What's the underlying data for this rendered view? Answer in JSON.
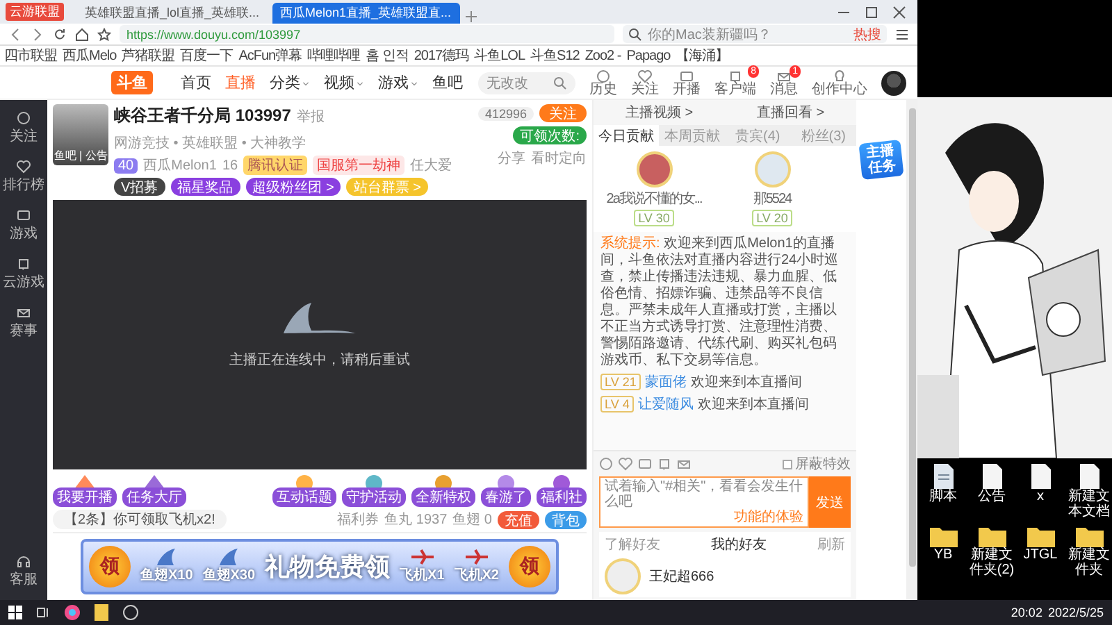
{
  "browser": {
    "logo_label": "云游联盟",
    "tabs": [
      {
        "title": "英雄联盟直播_lol直播_英雄联...",
        "selected": false
      },
      {
        "title": "西瓜Melon1直播_英雄联盟直...",
        "selected": true
      }
    ],
    "url": "https://www.douyu.com/103997",
    "search": {
      "placeholder": "你的Mac装新疆吗？",
      "hot": "热搜"
    },
    "bookmarks": [
      "四市联盟",
      "西瓜Melo",
      "芦猪联盟",
      "百度一下",
      "AcFun弹幕",
      "哔哩哔哩",
      "홈 인적",
      "2017德玛",
      "斗鱼LOL",
      "斗鱼S12",
      "Zoo2 -",
      "Papago",
      "【海涌】"
    ]
  },
  "site": {
    "logo": "斗鱼",
    "nav": [
      {
        "label": "首页",
        "selected": false,
        "dropdown": false
      },
      {
        "label": "直播",
        "selected": true,
        "dropdown": false
      },
      {
        "label": "分类",
        "selected": false,
        "dropdown": true
      },
      {
        "label": "视频",
        "selected": false,
        "dropdown": true
      },
      {
        "label": "游戏",
        "selected": false,
        "dropdown": true
      },
      {
        "label": "鱼吧",
        "selected": false,
        "dropdown": false
      }
    ],
    "search_placeholder": "无改改",
    "tools": [
      {
        "label": "历史"
      },
      {
        "label": "关注"
      },
      {
        "label": "开播"
      },
      {
        "label": "客户端",
        "badge": "8"
      },
      {
        "label": "消息",
        "badge": "1"
      },
      {
        "label": "创作中心"
      }
    ]
  },
  "sidebar": {
    "items": [
      "关注",
      "排行榜",
      "游戏",
      "云游戏",
      "赛事"
    ],
    "bottom": "客服"
  },
  "room": {
    "title": "峡谷王者千分局",
    "id": "103997",
    "report": "举报",
    "category": "网游竞技 • 英雄联盟 • 大神教学",
    "avatar_caption": "鱼吧 | 公告",
    "level": "40",
    "anchor": "西瓜Melon1",
    "heat": "16",
    "badges": [
      "腾讯认证",
      "国服第一劫神"
    ],
    "extra": "任大爱",
    "buttons": [
      "V招募",
      "福星奖品",
      "超级粉丝团 >",
      "站台群票 >"
    ],
    "followers": "412996",
    "follow": "关注",
    "claim": "可领次数:",
    "share": "分享",
    "other": "看时定向"
  },
  "video": {
    "message": "主播正在连线中，请稍后重试"
  },
  "gifts": {
    "left": [
      "我要开播",
      "任务大厅"
    ],
    "right": [
      "互动话题",
      "守护活动",
      "全新特权",
      "春游了",
      "福利社"
    ],
    "notice": "【2条】你可领取飞机x2!",
    "coupon": "福利券",
    "fish_ball": "鱼丸 1937",
    "fin": "鱼翅 0",
    "recharge": "充值",
    "backpack": "背包"
  },
  "banner": {
    "claim": [
      "领",
      "领"
    ],
    "title": "礼物免费领",
    "items": [
      "鱼翅X10",
      "鱼翅X30",
      "飞机X1",
      "飞机X2"
    ]
  },
  "panel": {
    "links": [
      "主播视频 >",
      "直播回看 >"
    ],
    "tabs": [
      {
        "label": "今日贡献",
        "selected": true
      },
      {
        "label": "本周贡献",
        "selected": false
      },
      {
        "label": "贵宾(4)",
        "selected": false
      },
      {
        "label": "粉丝(3)",
        "selected": false
      }
    ],
    "ranks": [
      {
        "name": "2a我说不懂的女...",
        "level": "LV 30"
      },
      {
        "name": "那5524",
        "level": "LV 20"
      }
    ],
    "chat": [
      {
        "kind": "system",
        "tag": "系统提示:",
        "text": "欢迎来到西瓜Melon1的直播间，斗鱼依法对直播内容进行24小时巡查，禁止传播违法违规、暴力血腥、低俗色情、招嫖诈骗、违禁品等不良信息。严禁未成年人直播或打赏，主播以不正当方式诱导打赏、注意理性消费、警惕陌路邀请、代练代刷、购买礼包码游戏币、私下交易等信息。"
      },
      {
        "kind": "user",
        "level": "LV 21",
        "name": "蒙面佬",
        "text": "欢迎来到本直播间"
      },
      {
        "kind": "user",
        "level": "LV 4",
        "name": "让爱随风",
        "text": "欢迎来到本直播间"
      }
    ],
    "shield": "屏蔽特效",
    "shield_checked": false,
    "placeholder": "试着输入\"#相关\"，看看会发生什么吧",
    "hint": "功能的体验",
    "send": "发送",
    "friends": {
      "learn": "了解好友",
      "title": "我的好友",
      "refresh": "刷新",
      "name": "王妃超666"
    },
    "task": "主播任务"
  },
  "desktop": {
    "icons": [
      {
        "label": "脚本",
        "kind": "file"
      },
      {
        "label": "公告",
        "kind": "doc"
      },
      {
        "label": "x",
        "kind": "doc"
      },
      {
        "label": "新建文本文档",
        "kind": "doc"
      },
      {
        "label": "YB",
        "kind": "folder"
      },
      {
        "label": "新建文件夹(2)",
        "kind": "folder"
      },
      {
        "label": "JTGL",
        "kind": "folder"
      },
      {
        "label": "新建文件夹",
        "kind": "folder"
      }
    ]
  },
  "taskbar": {
    "time": "20:02",
    "date": "2022/5/25"
  }
}
